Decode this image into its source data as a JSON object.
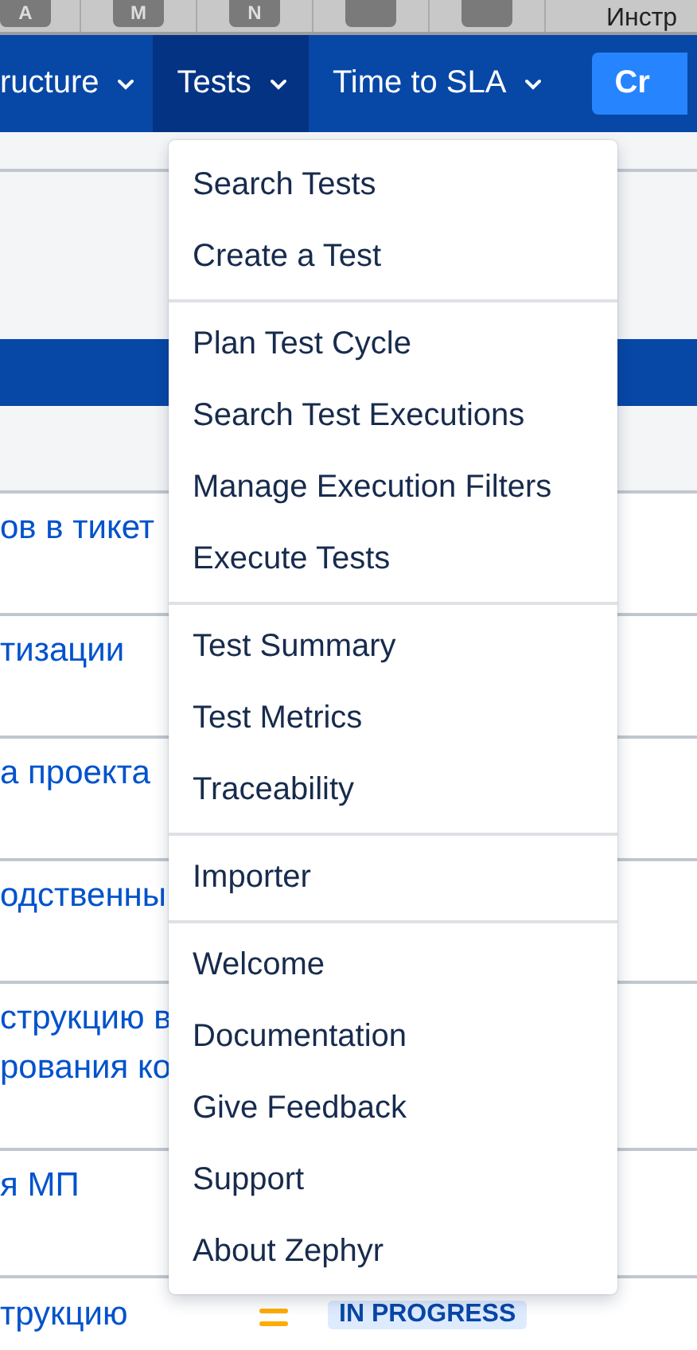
{
  "top_strip": {
    "keys": [
      {
        "kind": "letter",
        "label": "A"
      },
      {
        "kind": "letter",
        "label": "M"
      },
      {
        "kind": "letter",
        "label": "N"
      },
      {
        "kind": "blank"
      },
      {
        "kind": "blank"
      }
    ],
    "text": "Инстр"
  },
  "nav": {
    "items": [
      {
        "label": "ructure",
        "selected": false
      },
      {
        "label": "Tests",
        "selected": true
      },
      {
        "label": "Time to SLA",
        "selected": false
      }
    ],
    "create_button": "Cr"
  },
  "issues": [
    {
      "lines": [
        "ов в тикет"
      ]
    },
    {
      "lines": [
        "тизации"
      ]
    },
    {
      "lines": [
        "а проекта"
      ]
    },
    {
      "lines": [
        "одственны"
      ]
    },
    {
      "lines": [
        "струкцию в",
        "рования ко"
      ]
    },
    {
      "lines": [
        "я МП"
      ]
    },
    {
      "lines": [
        "трукцию"
      ],
      "priority_icon": true,
      "status": "IN PROGRESS"
    }
  ],
  "menu": {
    "groups": [
      {
        "items": [
          "Search Tests",
          "Create a Test"
        ]
      },
      {
        "items": [
          "Plan Test Cycle",
          "Search Test Executions",
          "Manage Execution Filters",
          "Execute Tests"
        ]
      },
      {
        "items": [
          "Test Summary",
          "Test Metrics",
          "Traceability"
        ]
      },
      {
        "items": [
          "Importer"
        ]
      },
      {
        "items": [
          "Welcome",
          "Documentation",
          "Give Feedback",
          "Support",
          "About Zephyr"
        ]
      }
    ]
  }
}
